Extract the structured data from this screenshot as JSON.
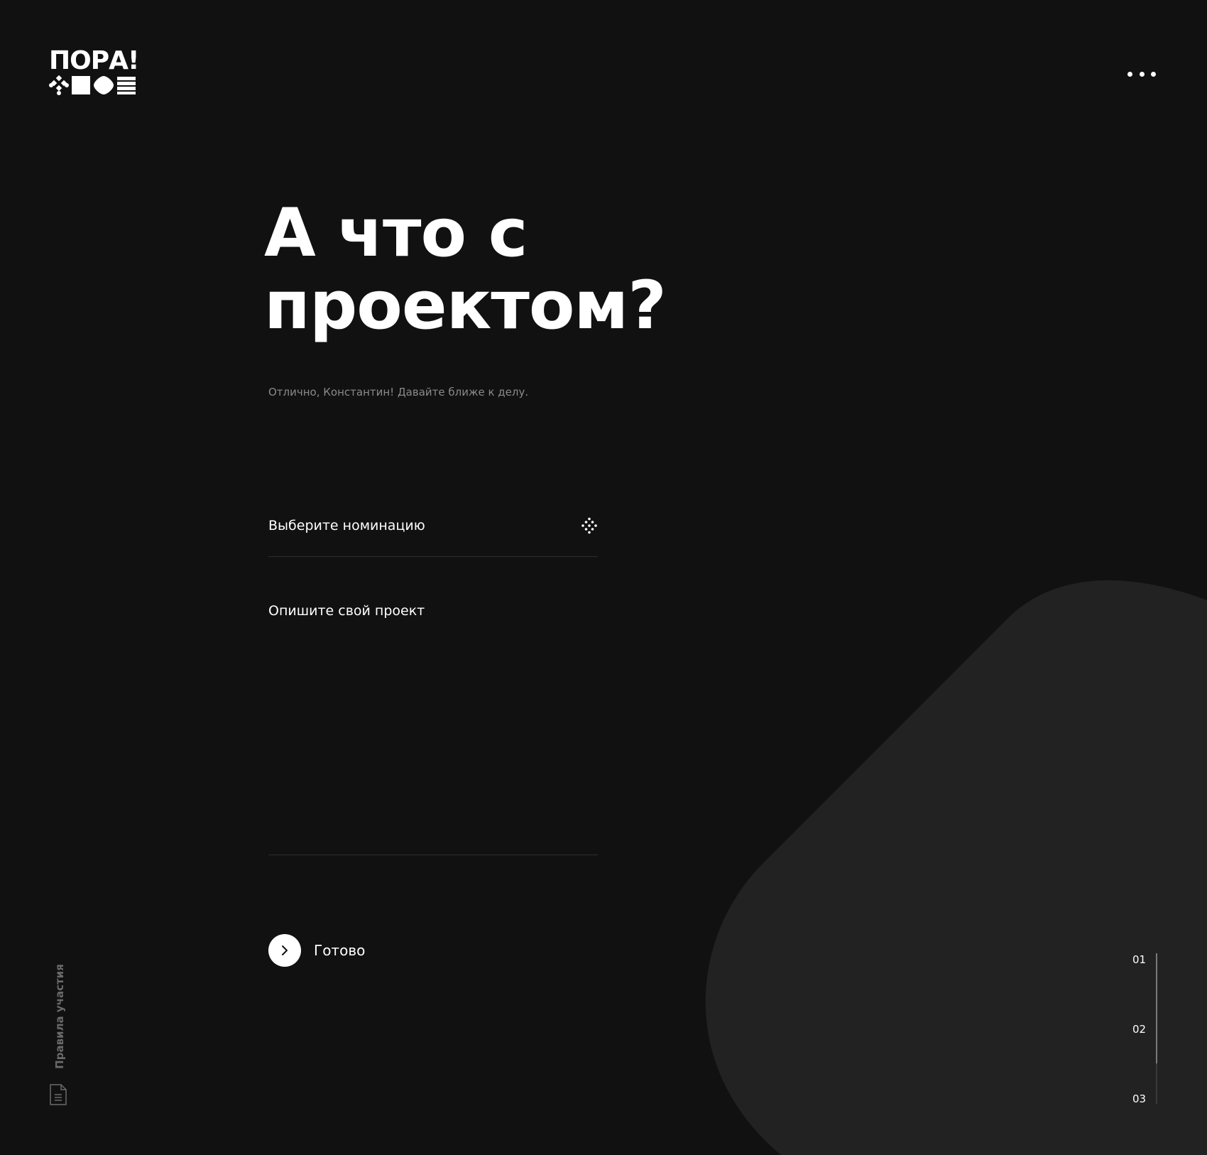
{
  "brand": {
    "logo_text": "ПОРА!"
  },
  "header": {
    "menu_icon": "more-horizontal-icon"
  },
  "main": {
    "title": "А что с проектом?",
    "subtitle": "Отлично, Константин! Давайте ближе к делу.",
    "nomination_field": {
      "label": "Выберите номинацию",
      "icon": "dots-diamond-icon"
    },
    "description_field": {
      "label": "Опишите свой проект",
      "value": ""
    },
    "submit": {
      "label": "Готово",
      "icon": "chevron-right-icon"
    }
  },
  "sidebar": {
    "rules_label": "Правила участия",
    "rules_icon": "document-icon"
  },
  "steps": {
    "items": [
      "01",
      "02",
      "03"
    ],
    "active_index": 1
  },
  "colors": {
    "background": "#111111",
    "shape": "#222222",
    "text": "#ffffff",
    "muted": "#8a8a8a"
  }
}
